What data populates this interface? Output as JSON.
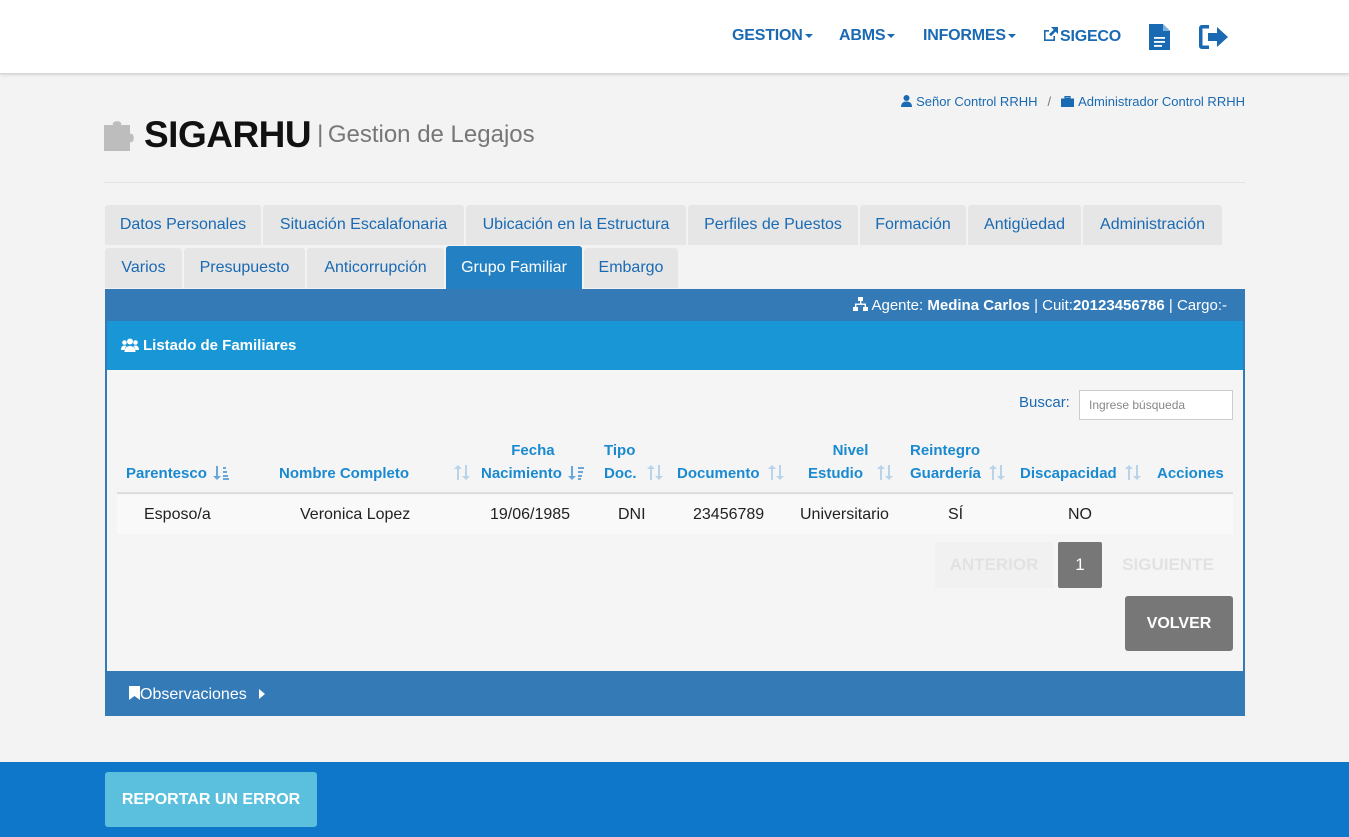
{
  "nav": {
    "gestion": "GESTION",
    "abms": "ABMS",
    "informes": "INFORMES",
    "sigeco": "SIGECO",
    "icons": [
      "document-icon",
      "logout-icon"
    ]
  },
  "user": {
    "name": "Señor Control RRHH",
    "separator": "/",
    "role": "Administrador Control RRHH"
  },
  "title": {
    "main": "SIGARHU",
    "separator": "|",
    "subtitle": "Gestion de Legajos"
  },
  "tabs": [
    {
      "label": "Datos Personales"
    },
    {
      "label": "Situación Escalafonaria"
    },
    {
      "label": "Ubicación en la Estructura"
    },
    {
      "label": "Perfiles de Puestos"
    },
    {
      "label": "Formación"
    },
    {
      "label": "Antigüedad"
    },
    {
      "label": "Administración"
    },
    {
      "label": "Varios"
    },
    {
      "label": "Presupuesto"
    },
    {
      "label": "Anticorrupción"
    },
    {
      "label": "Grupo Familiar",
      "active": true
    },
    {
      "label": "Embargo"
    }
  ],
  "agent": {
    "label": "Agente:",
    "name": "Medina Carlos",
    "cuit_label": "| Cuit:",
    "cuit": "20123456786",
    "cargo_label": "| Cargo:-"
  },
  "panel": {
    "title": "Listado de Familiares",
    "search_label": "Buscar:",
    "search_placeholder": "Ingrese búsqueda"
  },
  "table": {
    "headers": {
      "parentesco": "Parentesco",
      "nombre": "Nombre Completo",
      "fecha_1": "Fecha",
      "fecha_2": "Nacimiento",
      "tipo_1": "Tipo",
      "tipo_2": "Doc.",
      "documento": "Documento",
      "nivel_1": "Nivel",
      "nivel_2": "Estudio",
      "reintegro_1": "Reintegro",
      "reintegro_2": "Guardería",
      "discapacidad": "Discapacidad",
      "acciones": "Acciones"
    },
    "rows": [
      {
        "parentesco": "Esposo/a",
        "nombre": "Veronica Lopez",
        "fecha": "19/06/1985",
        "tipo": "DNI",
        "documento": "23456789",
        "nivel": "Universitario",
        "reintegro": "SÍ",
        "discapacidad": "NO",
        "acciones": ""
      }
    ]
  },
  "pagination": {
    "prev": "ANTERIOR",
    "page": "1",
    "next": "SIGUIENTE"
  },
  "buttons": {
    "volver": "VOLVER",
    "report": "REPORTAR UN ERROR"
  },
  "observaciones": "Observaciones",
  "colors": {
    "primary": "#337ab7",
    "panel_head": "#1996d5",
    "active_tab": "#2280c3",
    "footer": "#0e77c9",
    "report_button": "#5bc0de",
    "link": "#1a6ab3"
  }
}
